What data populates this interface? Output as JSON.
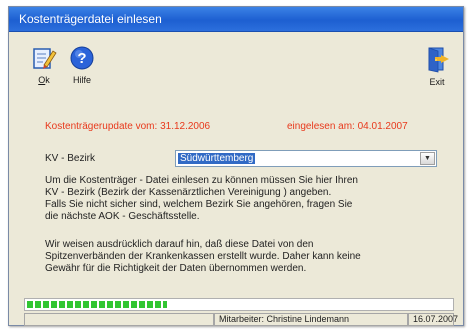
{
  "window": {
    "title": "Kostenträgerdatei einlesen"
  },
  "toolbar": {
    "ok": {
      "label_underlined": "O",
      "label_rest": "k",
      "icon": "ok-pencil-icon"
    },
    "help": {
      "label": "Hilfe",
      "icon": "help-question-icon"
    },
    "exit": {
      "label": "Exit",
      "icon": "exit-door-icon"
    }
  },
  "info": {
    "update": "Kostenträgerupdate vom: 31.12.2006",
    "imported": "eingelesen am: 04.01.2007",
    "accent_color": "#e8391c"
  },
  "kv": {
    "label": "KV - Bezirk",
    "selected": "Südwürttemberg"
  },
  "text": {
    "p1_l1": "Um die Kostenträger - Datei einlesen zu können müssen Sie hier Ihren",
    "p1_l2": "KV - Bezirk (Bezirk der Kassenärztlichen Vereinigung ) angeben.",
    "p1_l3": "Falls Sie nicht sicher sind, welchem Bezirk Sie angehören, fragen Sie",
    "p1_l4": "die nächste AOK - Geschäftsstelle.",
    "p2_l1": "Wir weisen ausdrücklich darauf hin, daß diese Datei von den",
    "p2_l2": "Spitzenverbänden der Krankenkassen erstellt wurde. Daher kann keine",
    "p2_l3": "Gewähr für die Richtigkeit der Daten übernommen werden."
  },
  "progress": {
    "fraction": 0.33,
    "color": "#31c531"
  },
  "status": {
    "user": "Mitarbeiter: Christine Lindemann",
    "date": "16.07.2007"
  }
}
